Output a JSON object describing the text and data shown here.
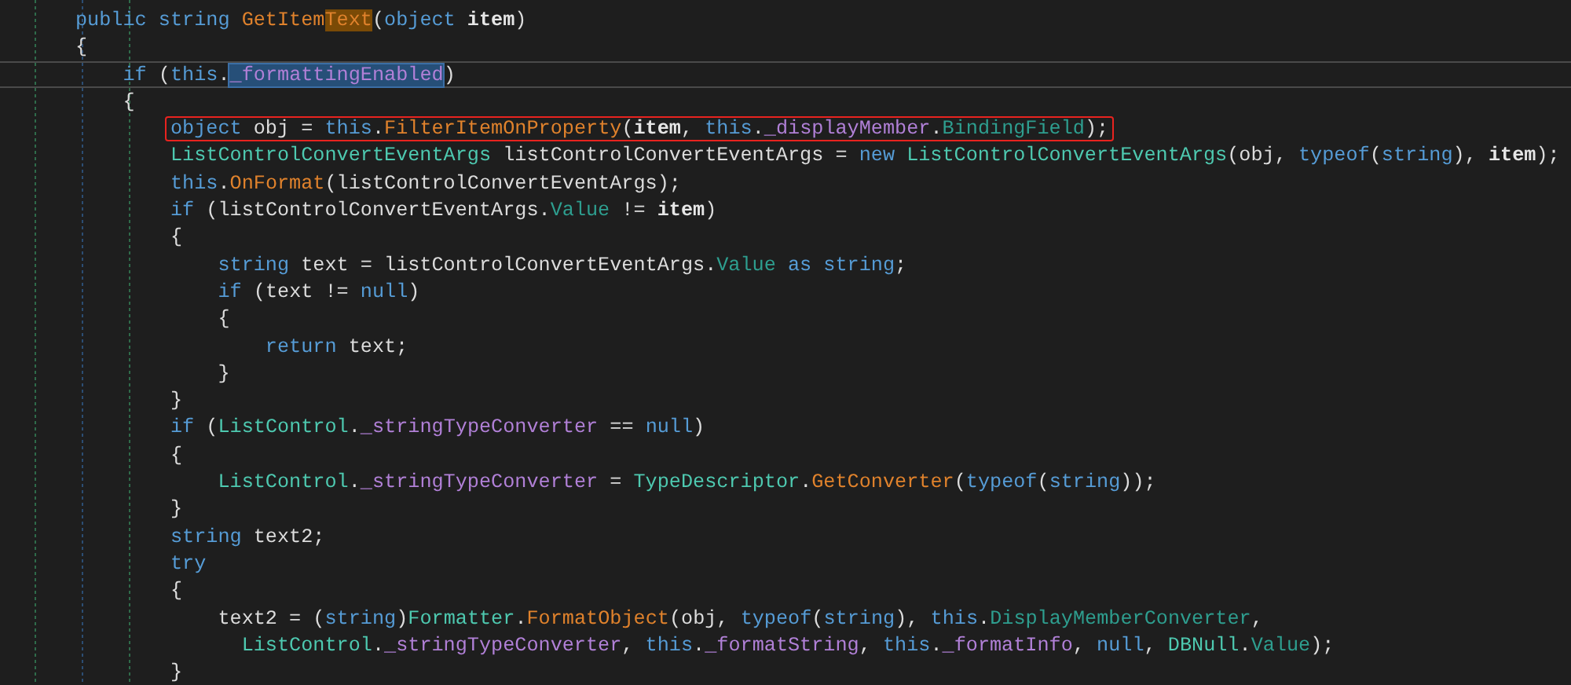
{
  "editor": {
    "lines": [
      {
        "tokens": [
          {
            "kind": "kw",
            "text": "public string "
          },
          {
            "kind": "method",
            "text": "GetItem"
          },
          {
            "kind": "method",
            "text": "Text",
            "highlighted": true
          },
          {
            "kind": "plain",
            "text": "("
          },
          {
            "kind": "kw",
            "text": "object "
          },
          {
            "kind": "param",
            "text": "item"
          },
          {
            "kind": "plain",
            "text": ")"
          }
        ]
      },
      {
        "tokens": [
          {
            "kind": "plain",
            "text": "{"
          }
        ]
      },
      {
        "current": true,
        "tokens": [
          {
            "kind": "kw",
            "text": "    if "
          },
          {
            "kind": "plain",
            "text": "("
          },
          {
            "kind": "kw",
            "text": "this"
          },
          {
            "kind": "plain",
            "text": "."
          },
          {
            "kind": "field",
            "text": "_formattingEnabled",
            "selected": true
          },
          {
            "kind": "plain",
            "text": ")"
          }
        ]
      },
      {
        "tokens": [
          {
            "kind": "plain",
            "text": "    {"
          }
        ]
      },
      {
        "boxed": true,
        "tokens": [
          {
            "kind": "kw",
            "text": "        object "
          },
          {
            "kind": "plain",
            "text": "obj = "
          },
          {
            "kind": "kw",
            "text": "this"
          },
          {
            "kind": "plain",
            "text": "."
          },
          {
            "kind": "method",
            "text": "FilterItemOnProperty"
          },
          {
            "kind": "plain",
            "text": "("
          },
          {
            "kind": "param",
            "text": "item"
          },
          {
            "kind": "plain",
            "text": ", "
          },
          {
            "kind": "kw",
            "text": "this"
          },
          {
            "kind": "plain",
            "text": "."
          },
          {
            "kind": "field",
            "text": "_displayMember"
          },
          {
            "kind": "plain",
            "text": "."
          },
          {
            "kind": "property",
            "text": "BindingField"
          },
          {
            "kind": "plain",
            "text": ");"
          }
        ]
      },
      {
        "tokens": [
          {
            "kind": "type",
            "text": "        ListControlConvertEventArgs "
          },
          {
            "kind": "plain",
            "text": "listControlConvertEventArgs = "
          },
          {
            "kind": "kw",
            "text": "new "
          },
          {
            "kind": "type",
            "text": "ListControlConvertEventArgs"
          },
          {
            "kind": "plain",
            "text": "(obj, "
          },
          {
            "kind": "kw",
            "text": "typeof"
          },
          {
            "kind": "plain",
            "text": "("
          },
          {
            "kind": "kw",
            "text": "string"
          },
          {
            "kind": "plain",
            "text": "), "
          },
          {
            "kind": "param",
            "text": "item"
          },
          {
            "kind": "plain",
            "text": ");"
          }
        ]
      },
      {
        "tokens": [
          {
            "kind": "kw",
            "text": "        this"
          },
          {
            "kind": "plain",
            "text": "."
          },
          {
            "kind": "method",
            "text": "OnFormat"
          },
          {
            "kind": "plain",
            "text": "(listControlConvertEventArgs);"
          }
        ]
      },
      {
        "tokens": [
          {
            "kind": "kw",
            "text": "        if "
          },
          {
            "kind": "plain",
            "text": "(listControlConvertEventArgs."
          },
          {
            "kind": "property",
            "text": "Value"
          },
          {
            "kind": "plain",
            "text": " != "
          },
          {
            "kind": "param",
            "text": "item"
          },
          {
            "kind": "plain",
            "text": ")"
          }
        ]
      },
      {
        "tokens": [
          {
            "kind": "plain",
            "text": "        {"
          }
        ]
      },
      {
        "tokens": [
          {
            "kind": "kw",
            "text": "            string "
          },
          {
            "kind": "plain",
            "text": "text = listControlConvertEventArgs."
          },
          {
            "kind": "property",
            "text": "Value"
          },
          {
            "kind": "kw",
            "text": " as string"
          },
          {
            "kind": "plain",
            "text": ";"
          }
        ]
      },
      {
        "tokens": [
          {
            "kind": "kw",
            "text": "            if "
          },
          {
            "kind": "plain",
            "text": "(text != "
          },
          {
            "kind": "kw",
            "text": "null"
          },
          {
            "kind": "plain",
            "text": ")"
          }
        ]
      },
      {
        "tokens": [
          {
            "kind": "plain",
            "text": "            {"
          }
        ]
      },
      {
        "tokens": [
          {
            "kind": "kw",
            "text": "                return "
          },
          {
            "kind": "plain",
            "text": "text;"
          }
        ]
      },
      {
        "tokens": [
          {
            "kind": "plain",
            "text": "            }"
          }
        ]
      },
      {
        "tokens": [
          {
            "kind": "plain",
            "text": "        }"
          }
        ]
      },
      {
        "tokens": [
          {
            "kind": "kw",
            "text": "        if "
          },
          {
            "kind": "plain",
            "text": "("
          },
          {
            "kind": "type",
            "text": "ListControl"
          },
          {
            "kind": "plain",
            "text": "."
          },
          {
            "kind": "field",
            "text": "_stringTypeConverter"
          },
          {
            "kind": "plain",
            "text": " == "
          },
          {
            "kind": "kw",
            "text": "null"
          },
          {
            "kind": "plain",
            "text": ")"
          }
        ]
      },
      {
        "tokens": [
          {
            "kind": "plain",
            "text": "        {"
          }
        ]
      },
      {
        "tokens": [
          {
            "kind": "type",
            "text": "            ListControl"
          },
          {
            "kind": "plain",
            "text": "."
          },
          {
            "kind": "field",
            "text": "_stringTypeConverter"
          },
          {
            "kind": "plain",
            "text": " = "
          },
          {
            "kind": "type",
            "text": "TypeDescriptor"
          },
          {
            "kind": "plain",
            "text": "."
          },
          {
            "kind": "method",
            "text": "GetConverter"
          },
          {
            "kind": "plain",
            "text": "("
          },
          {
            "kind": "kw",
            "text": "typeof"
          },
          {
            "kind": "plain",
            "text": "("
          },
          {
            "kind": "kw",
            "text": "string"
          },
          {
            "kind": "plain",
            "text": "));"
          }
        ]
      },
      {
        "tokens": [
          {
            "kind": "plain",
            "text": "        }"
          }
        ]
      },
      {
        "tokens": [
          {
            "kind": "kw",
            "text": "        string "
          },
          {
            "kind": "plain",
            "text": "text2;"
          }
        ]
      },
      {
        "tokens": [
          {
            "kind": "kw",
            "text": "        try"
          }
        ]
      },
      {
        "tokens": [
          {
            "kind": "plain",
            "text": "        {"
          }
        ]
      },
      {
        "tokens": [
          {
            "kind": "plain",
            "text": "            text2 = ("
          },
          {
            "kind": "kw",
            "text": "string"
          },
          {
            "kind": "plain",
            "text": ")"
          },
          {
            "kind": "type",
            "text": "Formatter"
          },
          {
            "kind": "plain",
            "text": "."
          },
          {
            "kind": "method",
            "text": "FormatObject"
          },
          {
            "kind": "plain",
            "text": "(obj, "
          },
          {
            "kind": "kw",
            "text": "typeof"
          },
          {
            "kind": "plain",
            "text": "("
          },
          {
            "kind": "kw",
            "text": "string"
          },
          {
            "kind": "plain",
            "text": "), "
          },
          {
            "kind": "kw",
            "text": "this"
          },
          {
            "kind": "plain",
            "text": "."
          },
          {
            "kind": "property",
            "text": "DisplayMemberConverter"
          },
          {
            "kind": "plain",
            "text": ","
          }
        ]
      },
      {
        "tokens": [
          {
            "kind": "type",
            "text": "              ListControl"
          },
          {
            "kind": "plain",
            "text": "."
          },
          {
            "kind": "field",
            "text": "_stringTypeConverter"
          },
          {
            "kind": "plain",
            "text": ", "
          },
          {
            "kind": "kw",
            "text": "this"
          },
          {
            "kind": "plain",
            "text": "."
          },
          {
            "kind": "field",
            "text": "_formatString"
          },
          {
            "kind": "plain",
            "text": ", "
          },
          {
            "kind": "kw",
            "text": "this"
          },
          {
            "kind": "plain",
            "text": "."
          },
          {
            "kind": "field",
            "text": "_formatInfo"
          },
          {
            "kind": "plain",
            "text": ", "
          },
          {
            "kind": "kw",
            "text": "null"
          },
          {
            "kind": "plain",
            "text": ", "
          },
          {
            "kind": "type",
            "text": "DBNull"
          },
          {
            "kind": "plain",
            "text": "."
          },
          {
            "kind": "property",
            "text": "Value"
          },
          {
            "kind": "plain",
            "text": ");"
          }
        ]
      },
      {
        "tokens": [
          {
            "kind": "plain",
            "text": "        }"
          }
        ]
      }
    ]
  }
}
